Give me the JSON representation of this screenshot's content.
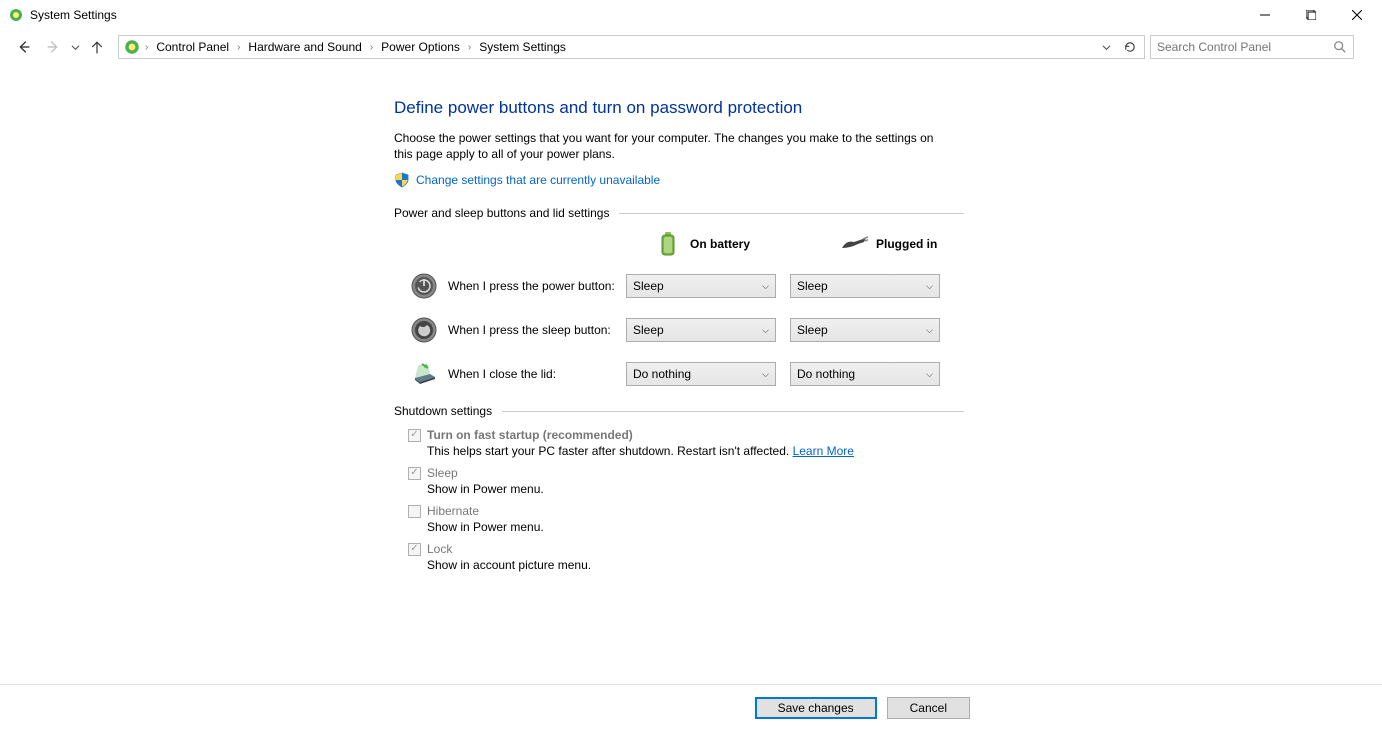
{
  "window": {
    "title": "System Settings"
  },
  "breadcrumb": {
    "items": [
      "Control Panel",
      "Hardware and Sound",
      "Power Options",
      "System Settings"
    ]
  },
  "search": {
    "placeholder": "Search Control Panel"
  },
  "page": {
    "heading": "Define power buttons and turn on password protection",
    "description": "Choose the power settings that you want for your computer. The changes you make to the settings on this page apply to all of your power plans.",
    "admin_link": "Change settings that are currently unavailable"
  },
  "section1": {
    "title": "Power and sleep buttons and lid settings",
    "columns": {
      "battery": "On battery",
      "plugged": "Plugged in"
    },
    "rows": [
      {
        "label": "When I press the power button:",
        "battery": "Sleep",
        "plugged": "Sleep"
      },
      {
        "label": "When I press the sleep button:",
        "battery": "Sleep",
        "plugged": "Sleep"
      },
      {
        "label": "When I close the lid:",
        "battery": "Do nothing",
        "plugged": "Do nothing"
      }
    ]
  },
  "section2": {
    "title": "Shutdown settings",
    "items": [
      {
        "label": "Turn on fast startup (recommended)",
        "sub": "This helps start your PC faster after shutdown. Restart isn't affected. ",
        "link": "Learn More",
        "checked": true,
        "bold": true
      },
      {
        "label": "Sleep",
        "sub": "Show in Power menu.",
        "checked": true
      },
      {
        "label": "Hibernate",
        "sub": "Show in Power menu.",
        "checked": false
      },
      {
        "label": "Lock",
        "sub": "Show in account picture menu.",
        "checked": true
      }
    ]
  },
  "footer": {
    "save": "Save changes",
    "cancel": "Cancel"
  }
}
